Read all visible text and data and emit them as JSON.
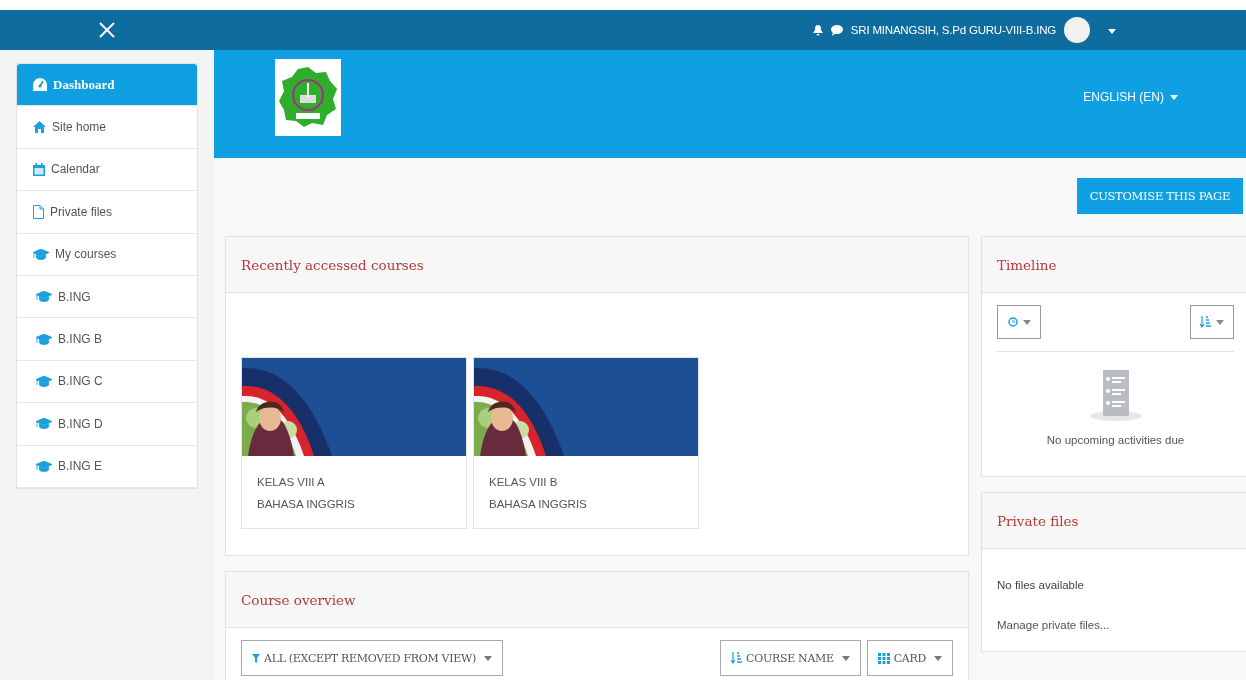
{
  "topbar": {
    "user_name": "SRI MINANGSIH, S.Pd GURU-VIII-B.ING"
  },
  "sidebar": {
    "items": [
      {
        "label": "Dashboard",
        "kind": "dashboard",
        "selected": true
      },
      {
        "label": "Site home",
        "kind": "home",
        "selected": false
      },
      {
        "label": "Calendar",
        "kind": "calendar",
        "selected": false
      },
      {
        "label": "Private files",
        "kind": "file",
        "selected": false
      },
      {
        "label": "My courses",
        "kind": "courses",
        "selected": false
      },
      {
        "label": "B.ING",
        "kind": "course",
        "selected": false
      },
      {
        "label": "B.ING B",
        "kind": "course",
        "selected": false
      },
      {
        "label": "B.ING C",
        "kind": "course",
        "selected": false
      },
      {
        "label": "B.ING D",
        "kind": "course",
        "selected": false
      },
      {
        "label": "B.ING E",
        "kind": "course",
        "selected": false
      }
    ]
  },
  "header": {
    "language": "ENGLISH (EN)"
  },
  "customise_button": "CUSTOMISE THIS PAGE",
  "recent": {
    "title": "Recently accessed courses",
    "courses": [
      {
        "kind": "picture",
        "category": "KELAS VIII A",
        "name": "BAHASA INGGRIS"
      },
      {
        "kind": "picture",
        "category": "KELAS VIII B",
        "name": "BAHASA INGGRIS"
      }
    ]
  },
  "overview": {
    "title": "Course overview",
    "filter": "ALL (EXCEPT REMOVED FROM VIEW)",
    "sort": "COURSE NAME",
    "view": "CARD"
  },
  "timeline": {
    "title": "Timeline",
    "empty": "No upcoming activities due"
  },
  "private_files": {
    "title": "Private files",
    "empty": "No files available",
    "link": "Manage private files..."
  }
}
